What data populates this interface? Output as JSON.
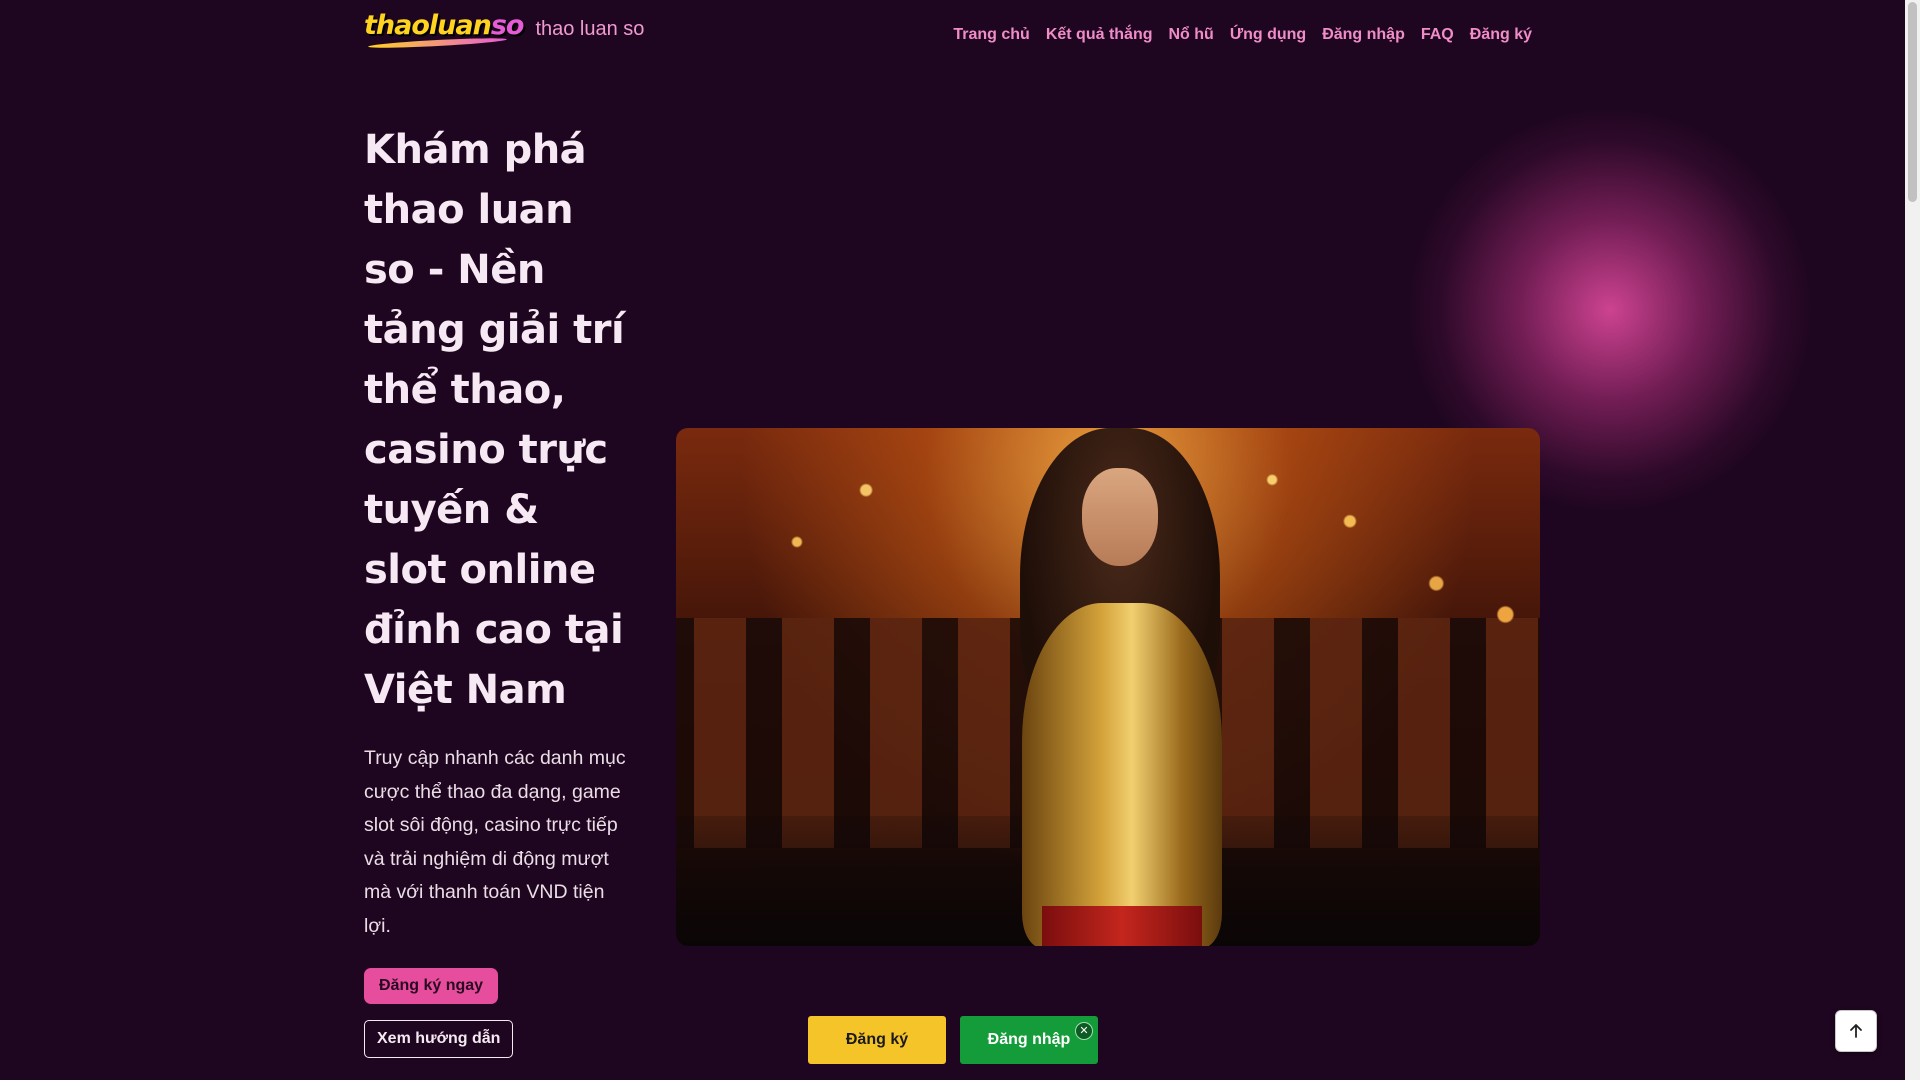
{
  "header": {
    "logo_part1": "thaoluan",
    "logo_part2": "so",
    "site_name": "thao luan so",
    "nav": [
      {
        "label": "Trang chủ"
      },
      {
        "label": "Kết quả thắng"
      },
      {
        "label": "Nổ hũ"
      },
      {
        "label": "Ứng dụng"
      },
      {
        "label": "Đăng nhập"
      },
      {
        "label": "FAQ"
      },
      {
        "label": "Đăng ký"
      }
    ]
  },
  "hero": {
    "title": "Khám phá thao luan so - Nền tảng giải trí thể thao, casino trực tuyến & slot online đỉnh cao tại Việt Nam",
    "description": "Truy cập nhanh các danh mục cược thể thao đa dạng, game slot sôi động, casino trực tiếp và trải nghiệm di động mượt mà với thanh toán VND tiện lợi.",
    "primary_cta": "Đăng ký ngay",
    "secondary_cta": "Xem hướng dẫn"
  },
  "sticky_bar": {
    "register_label": "Đăng ký",
    "login_label": "Đăng nhập",
    "close_symbol": "✕"
  },
  "icons": {
    "back_to_top": "arrow-up-icon",
    "close": "close-icon"
  },
  "colors": {
    "background": "#1f0620",
    "accent_pink": "#e64d9c",
    "nav_link": "#f08cc8",
    "register": "#f5c428",
    "login": "#159c3a"
  }
}
